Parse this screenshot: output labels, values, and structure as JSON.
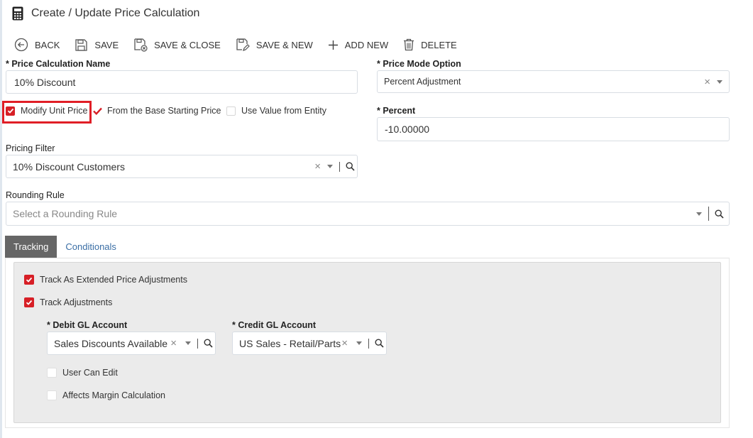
{
  "header": {
    "title": "Create / Update Price Calculation",
    "icon": "calculator-icon"
  },
  "toolbar": {
    "back": "BACK",
    "save": "SAVE",
    "save_close": "SAVE & CLOSE",
    "save_new": "SAVE & NEW",
    "add_new": "ADD NEW",
    "delete": "DELETE"
  },
  "form": {
    "price_calc_name_label": "* Price Calculation Name",
    "price_calc_name_value": "10% Discount",
    "price_mode_label": "* Price Mode Option",
    "price_mode_value": "Percent Adjustment",
    "modify_unit_price_label": "Modify Unit Price",
    "modify_unit_price_checked": true,
    "from_base_label": "From the Base Starting Price",
    "from_base_checked": true,
    "use_value_entity_label": "Use Value from Entity",
    "use_value_entity_checked": false,
    "percent_label": "* Percent",
    "percent_value": "-10.00000",
    "pricing_filter_label": "Pricing Filter",
    "pricing_filter_value": "10% Discount Customers",
    "rounding_rule_label": "Rounding Rule",
    "rounding_rule_placeholder": "Select a Rounding Rule"
  },
  "tabs": [
    {
      "label": "Tracking",
      "active": true
    },
    {
      "label": "Conditionals",
      "active": false
    }
  ],
  "tracking": {
    "track_extended_label": "Track As Extended Price Adjustments",
    "track_extended_checked": true,
    "track_adjustments_label": "Track Adjustments",
    "track_adjustments_checked": true,
    "debit_gl_label": "* Debit GL Account",
    "debit_gl_value": "Sales Discounts Available",
    "credit_gl_label": "* Credit GL Account",
    "credit_gl_value": "US Sales - Retail/Parts",
    "user_can_edit_label": "User Can Edit",
    "user_can_edit_checked": false,
    "affects_margin_label": "Affects Margin Calculation",
    "affects_margin_checked": false
  },
  "colors": {
    "accent_red": "#d71f26",
    "tab_active": "#666666",
    "link_blue": "#3a6ea5"
  }
}
